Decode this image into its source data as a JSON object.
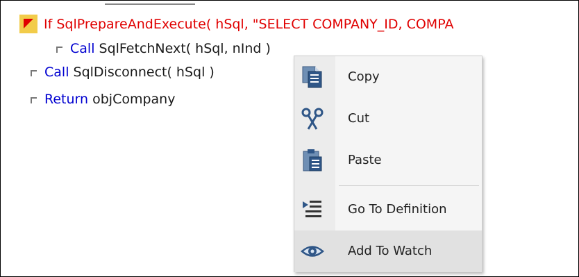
{
  "code": {
    "line1": {
      "keyword": "If",
      "text": "SqlPrepareAndExecute( hSql, \"SELECT COMPANY_ID, COMPA"
    },
    "line2": {
      "keyword": "Call",
      "text": "SqlFetchNext( hSql, nInd )"
    },
    "line3": {
      "keyword": "Call",
      "text": "SqlDisconnect( hSql )"
    },
    "line4": {
      "keyword": "Return",
      "text": "objCompany"
    }
  },
  "context_menu": {
    "items": [
      {
        "label": "Copy",
        "icon": "copy-icon"
      },
      {
        "label": "Cut",
        "icon": "scissors-icon"
      },
      {
        "label": "Paste",
        "icon": "paste-icon"
      },
      {
        "label": "Go To Definition",
        "icon": "go-to-definition-icon"
      },
      {
        "label": "Add To Watch",
        "icon": "eye-icon",
        "highlighted": true
      }
    ]
  },
  "colors": {
    "keyword": "#0000d0",
    "breakpoint_line": "#e00000",
    "breakpoint_marker": "#f2cc4a",
    "menu_highlight": "#e1e1e1"
  }
}
